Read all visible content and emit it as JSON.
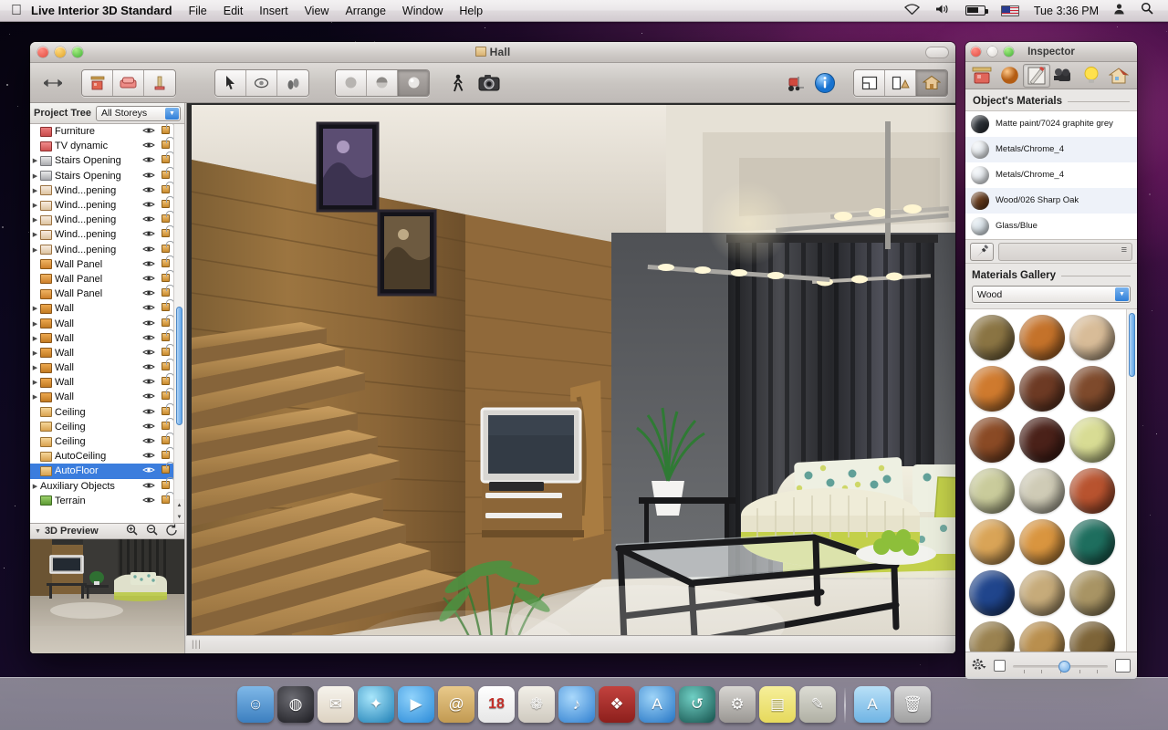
{
  "menubar": {
    "apple_icon": "apple-icon",
    "app_name": "Live Interior 3D Standard",
    "items": [
      "File",
      "Edit",
      "Insert",
      "View",
      "Arrange",
      "Window",
      "Help"
    ],
    "status": {
      "wifi_icon": "wifi-icon",
      "volume_icon": "volume-icon",
      "battery_icon": "battery-icon",
      "flag_icon": "us-flag-icon",
      "clock": "Tue 3:36 PM",
      "user_icon": "user-icon",
      "search_icon": "spotlight-search-icon"
    }
  },
  "document_window": {
    "title": "Hall",
    "toolbar": {
      "resize_icon": "resize-arrows-icon",
      "left_group": [
        "building-icon",
        "furniture-icon",
        "materials-icon"
      ],
      "mid_group": [
        "pointer-icon",
        "orbit-icon",
        "walk-icon"
      ],
      "render_group": [
        "shade-flat-icon",
        "shade-smooth-icon",
        "shade-glossy-icon"
      ],
      "walk_icon": "walkthrough-icon",
      "camera_icon": "camera-icon",
      "forklift_icon": "forklift-icon",
      "info_icon": "info-icon",
      "view_group": [
        "plan-view-icon",
        "split-view-icon",
        "3d-view-icon"
      ]
    },
    "project_tree": {
      "label": "Project Tree",
      "storey_selector": "All Storeys",
      "items": [
        {
          "label": "Furniture",
          "icon": "furn",
          "disclosure": false,
          "selected": false
        },
        {
          "label": "TV dynamic",
          "icon": "tv",
          "disclosure": false,
          "selected": false
        },
        {
          "label": "Stairs Opening",
          "icon": "stair",
          "disclosure": true,
          "selected": false
        },
        {
          "label": "Stairs Opening",
          "icon": "stair",
          "disclosure": true,
          "selected": false
        },
        {
          "label": "Wind...pening",
          "icon": "win",
          "disclosure": true,
          "selected": false
        },
        {
          "label": "Wind...pening",
          "icon": "win",
          "disclosure": true,
          "selected": false
        },
        {
          "label": "Wind...pening",
          "icon": "win",
          "disclosure": true,
          "selected": false
        },
        {
          "label": "Wind...pening",
          "icon": "win",
          "disclosure": true,
          "selected": false
        },
        {
          "label": "Wind...pening",
          "icon": "win",
          "disclosure": true,
          "selected": false
        },
        {
          "label": "Wall Panel",
          "icon": "panel",
          "disclosure": false,
          "selected": false
        },
        {
          "label": "Wall Panel",
          "icon": "panel",
          "disclosure": false,
          "selected": false
        },
        {
          "label": "Wall Panel",
          "icon": "panel",
          "disclosure": false,
          "selected": false
        },
        {
          "label": "Wall",
          "icon": "wall",
          "disclosure": true,
          "selected": false
        },
        {
          "label": "Wall",
          "icon": "wall",
          "disclosure": true,
          "selected": false
        },
        {
          "label": "Wall",
          "icon": "wall",
          "disclosure": true,
          "selected": false
        },
        {
          "label": "Wall",
          "icon": "wall",
          "disclosure": true,
          "selected": false
        },
        {
          "label": "Wall",
          "icon": "wall",
          "disclosure": true,
          "selected": false
        },
        {
          "label": "Wall",
          "icon": "wall",
          "disclosure": true,
          "selected": false
        },
        {
          "label": "Wall",
          "icon": "wall",
          "disclosure": true,
          "selected": false
        },
        {
          "label": "Ceiling",
          "icon": "ceil",
          "disclosure": false,
          "selected": false
        },
        {
          "label": "Ceiling",
          "icon": "ceil",
          "disclosure": false,
          "selected": false
        },
        {
          "label": "Ceiling",
          "icon": "ceil",
          "disclosure": false,
          "selected": false
        },
        {
          "label": "AutoCeiling",
          "icon": "ceil",
          "disclosure": false,
          "selected": false
        },
        {
          "label": "AutoFloor",
          "icon": "ceil",
          "disclosure": false,
          "selected": true
        },
        {
          "label": "Auxiliary Objects",
          "icon": "none",
          "disclosure": true,
          "selected": false
        },
        {
          "label": "Terrain",
          "icon": "terr",
          "disclosure": false,
          "selected": false
        }
      ],
      "column_icons": {
        "visibility": "eye-icon",
        "lock": "unlocked-padlock-icon"
      }
    },
    "preview_panel": {
      "label": "3D Preview",
      "disclosure_icon": "triangle-down-icon",
      "zoom_in_icon": "zoom-in-icon",
      "zoom_out_icon": "zoom-out-icon",
      "rotate_icon": "rotate-icon"
    },
    "statusbar": {
      "grip_icon": "resize-grip-icon"
    }
  },
  "inspector": {
    "title": "Inspector",
    "tabs": [
      {
        "name": "object-tab",
        "icon": "furniture-ruler-icon",
        "active": false
      },
      {
        "name": "materials-tab",
        "icon": "material-sphere-icon",
        "active": false
      },
      {
        "name": "edit-tab",
        "icon": "pencil-icon",
        "active": true
      },
      {
        "name": "camera-tab",
        "icon": "camera-icon",
        "active": false
      },
      {
        "name": "light-tab",
        "icon": "lightbulb-icon",
        "active": false
      },
      {
        "name": "building-tab",
        "icon": "house-icon",
        "active": false
      }
    ],
    "objects_materials": {
      "heading": "Object's Materials",
      "items": [
        {
          "name": "Matte paint/7024 graphite grey",
          "color": "#2b3036"
        },
        {
          "name": "Metals/Chrome_4",
          "color": "#eef2f6"
        },
        {
          "name": "Metals/Chrome_4",
          "color": "#eef2f6"
        },
        {
          "name": "Wood/026 Sharp Oak",
          "color": "#64391a"
        },
        {
          "name": "Glass/Blue",
          "color": "#dfe8ee"
        }
      ],
      "eyedropper_icon": "eyedropper-icon",
      "list_icon": "list-lines-icon"
    },
    "materials_gallery": {
      "heading": "Materials Gallery",
      "category": "Wood",
      "swatches": [
        "#8a7443",
        "#c4722a",
        "#d8bc98",
        "#cf7a2e",
        "#6d3a24",
        "#7e4a2c",
        "#8a4a25",
        "#4a2119",
        "#d8dc94",
        "#c9cb9b",
        "#cfcbb6",
        "#b8532f",
        "#d9a457",
        "#d9953f",
        "#1e6e5e",
        "#20458c",
        "#c6ab7a",
        "#a89464",
        "#9a8250",
        "#b98f4e",
        "#7d6438"
      ],
      "footer": {
        "gear_icon": "gear-dropdown-icon",
        "small_icon": "small-thumbnail-icon",
        "large_icon": "large-thumbnail-icon",
        "slider_value": 50
      },
      "scrollbar_icon": "vertical-scrollbar"
    }
  },
  "dock": {
    "items": [
      {
        "name": "finder",
        "icon": "finder-icon",
        "bg": "linear-gradient(#7fb8e8,#3c7fc0)",
        "glyph": "☺",
        "running": true
      },
      {
        "name": "dashboard",
        "icon": "dashboard-icon",
        "bg": "radial-gradient(circle at 40% 32%,#6b6b72,#1b1b20)",
        "glyph": "◍",
        "running": false
      },
      {
        "name": "mail",
        "icon": "mail-icon",
        "bg": "linear-gradient(#f6f3ec,#ddd3c2)",
        "glyph": "✉",
        "running": false
      },
      {
        "name": "safari",
        "icon": "safari-icon",
        "bg": "radial-gradient(circle at 38% 30%,#a8e6fb,#1e7fb5)",
        "glyph": "✦",
        "running": false
      },
      {
        "name": "facetime",
        "icon": "facetime-icon",
        "bg": "radial-gradient(circle at 38% 30%,#8fd2fb,#2a8ad8)",
        "glyph": "▶",
        "running": false
      },
      {
        "name": "address-book",
        "icon": "address-book-icon",
        "bg": "linear-gradient(#e8c98a,#c29a52)",
        "glyph": "@",
        "running": false
      },
      {
        "name": "calendar",
        "icon": "calendar-icon",
        "bg": "linear-gradient(#ffffff,#e6e6e6)",
        "glyph": "18",
        "running": false
      },
      {
        "name": "iphoto",
        "icon": "iphoto-icon",
        "bg": "linear-gradient(#f2efe8,#cfcac0)",
        "glyph": "❁",
        "running": false
      },
      {
        "name": "itunes",
        "icon": "itunes-icon",
        "bg": "radial-gradient(circle at 38% 30%,#a9d8fb,#2f7fd0)",
        "glyph": "♪",
        "running": false
      },
      {
        "name": "photo-booth",
        "icon": "photo-booth-icon",
        "bg": "linear-gradient(#c2423e,#8d1f1c)",
        "glyph": "❖",
        "running": false
      },
      {
        "name": "app-store",
        "icon": "app-store-icon",
        "bg": "radial-gradient(circle at 38% 30%,#9ed4f8,#2474c4)",
        "glyph": "A",
        "running": false
      },
      {
        "name": "time-machine",
        "icon": "time-machine-icon",
        "bg": "radial-gradient(circle at 38% 30%,#6fcfc4,#15514c)",
        "glyph": "↺",
        "running": false
      },
      {
        "name": "system-preferences",
        "icon": "system-preferences-icon",
        "bg": "linear-gradient(#d8d6d2,#9a9793)",
        "glyph": "⚙",
        "running": false
      },
      {
        "name": "stickies",
        "icon": "stickies-icon",
        "bg": "linear-gradient(#f6ef9a,#e6d95c)",
        "glyph": "▤",
        "running": false
      },
      {
        "name": "gimp",
        "icon": "gimp-icon",
        "bg": "linear-gradient(#dcdcd4,#b0b0a4)",
        "glyph": "✎",
        "running": true
      }
    ],
    "right_items": [
      {
        "name": "applications-folder",
        "icon": "applications-folder-icon",
        "bg": "linear-gradient(#b9e0f7,#6fb4e4)",
        "glyph": "A"
      },
      {
        "name": "trash",
        "icon": "trash-icon",
        "bg": "linear-gradient(#d8d8d8,#a0a0a0)",
        "glyph": "🗑"
      }
    ],
    "separator_icon": "dock-separator"
  },
  "colors": {
    "accent_blue": "#3b7ddd",
    "window_chrome": "#d8d6d4",
    "selection": "#3b7ddd"
  }
}
